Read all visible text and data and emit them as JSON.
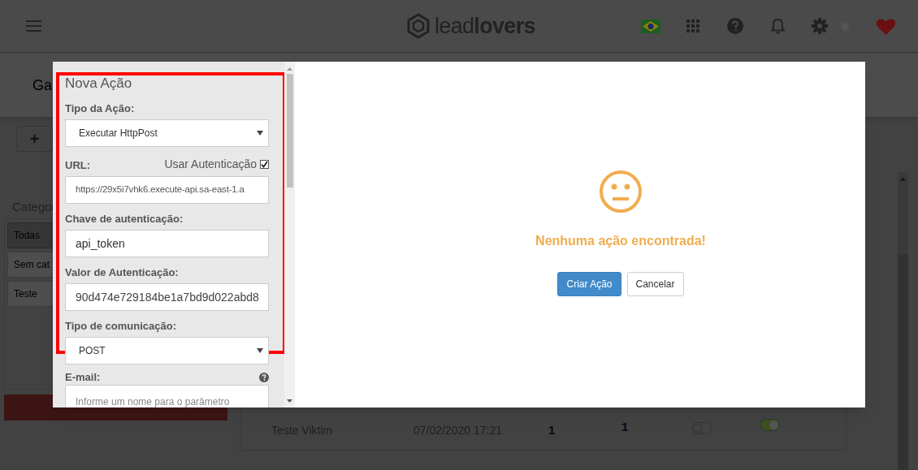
{
  "header": {
    "logo": "lead**lovers**"
  },
  "page": {
    "title": "Ga",
    "toolbar_button": "+",
    "categories_title": "Categor",
    "categories": [
      {
        "label": "Todas",
        "selected": true
      },
      {
        "label": "Sem cat",
        "selected": false
      },
      {
        "label": "Teste",
        "selected": false
      }
    ],
    "table_row": {
      "name": "Teste Viktim",
      "date": "07/02/2020 17:21",
      "column_3": "1",
      "column_4": "1",
      "toggles": [
        {
          "on": false
        },
        {
          "on": true
        }
      ]
    }
  },
  "modal": {
    "title": "Nova Ação",
    "fields": [
      {
        "kind": "select",
        "label": "Tipo da Ação:",
        "value": "Executar HttpPost"
      },
      {
        "kind": "text",
        "label": "URL:",
        "value": "https://29x5i7vhk6.execute-api.sa-east-1.a",
        "option": {
          "label": "Usar Autenticação",
          "checked": true
        }
      },
      {
        "kind": "text",
        "label": "Chave de autenticação:",
        "value": "api_token"
      },
      {
        "kind": "secret",
        "label": "Valor de Autenticação:",
        "value": "90d474e729184be1a7bd9d022abd8"
      },
      {
        "kind": "select",
        "label": "Tipo de comunicação:",
        "value": "POST"
      }
    ],
    "extra_field": {
      "label": "E-mail:",
      "placeholder": "Informe um nome para o parâmetro"
    },
    "empty_state": {
      "message": "Nenhuma ação encontrada!"
    },
    "buttons": [
      {
        "label": "Criar Ação",
        "kind": "primary"
      },
      {
        "label": "Cancelar",
        "kind": "default"
      }
    ]
  }
}
